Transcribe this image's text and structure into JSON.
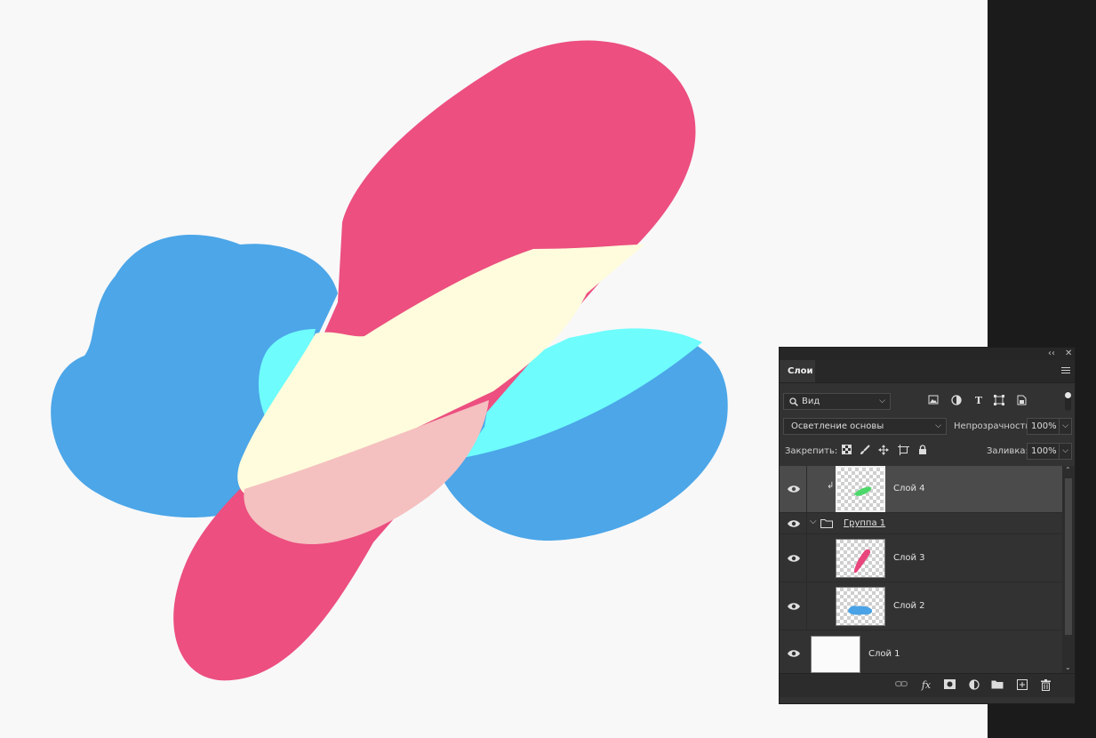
{
  "panel": {
    "collapse_glyph": "‹‹",
    "close_glyph": "✕",
    "tab_label": "Слои",
    "filter": {
      "icon": "search-icon",
      "value": "Вид"
    },
    "filter_icons": [
      "image-icon",
      "adjustment-icon",
      "type-icon",
      "transform-icon",
      "smart-object-icon"
    ],
    "blend_mode": "Осветление основы",
    "opacity_label": "Непрозрачность:",
    "opacity_value": "100%",
    "lock_label": "Закрепить:",
    "lock_icons": [
      "lock-transparent-pixels-icon",
      "lock-image-pixels-icon",
      "lock-position-icon",
      "artboard-lock-icon",
      "lock-all-icon"
    ],
    "fill_label": "Заливка:",
    "fill_value": "100%"
  },
  "layers": [
    {
      "name": "Слой 4",
      "visible": true,
      "selected": true,
      "clipped": true,
      "thumb_color": "#4cd86a"
    },
    {
      "name": "Группа 1",
      "visible": true,
      "type": "group",
      "expanded": true
    },
    {
      "name": "Слой 3",
      "visible": true,
      "thumb_color": "#e8467c"
    },
    {
      "name": "Слой 2",
      "visible": true,
      "thumb_color": "#4aa3e6"
    },
    {
      "name": "Слой 1",
      "visible": true,
      "thumb_color": "#fbfbfb"
    }
  ],
  "bottom_icons": [
    "link-layers-icon",
    "fx-icon",
    "layer-mask-icon",
    "adjustment-layer-icon",
    "new-group-icon",
    "new-layer-icon",
    "delete-icon"
  ],
  "fx_label": "fx",
  "colors": {
    "canvas_bg": "#f8f8f9",
    "pink": "#ec4f80",
    "blue": "#4ca6e8",
    "cyan": "#6efcfc",
    "cream": "#fefcdc",
    "peach": "#f5c0c0"
  }
}
